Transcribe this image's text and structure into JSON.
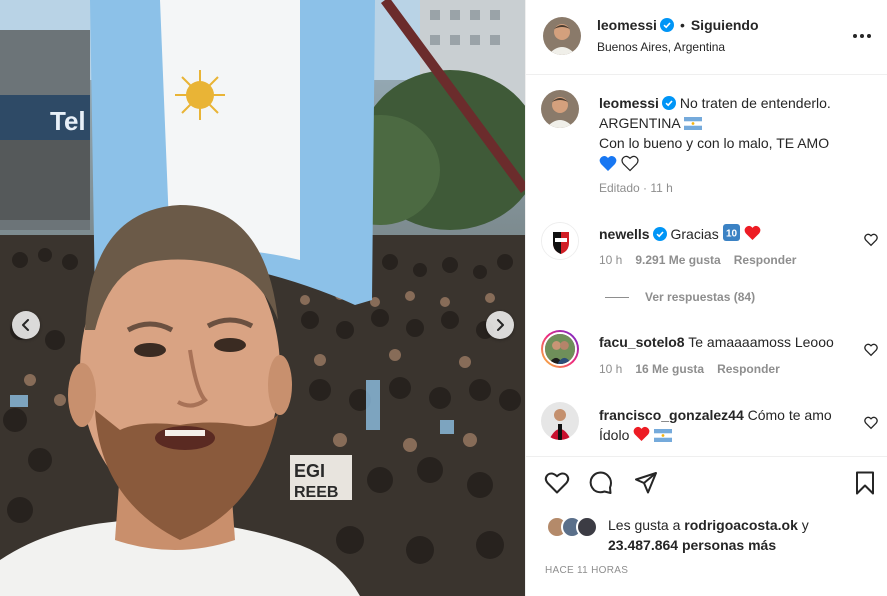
{
  "post": {
    "author": "leomessi",
    "follow_status": "Siguiendo",
    "location": "Buenos Aires, Argentina",
    "caption_line1": "No traten de entenderlo.",
    "caption_line2": "ARGENTINA",
    "caption_line3": "Con lo bueno y con lo malo, TE AMO",
    "edited": "Editado · 11 h",
    "photo_banner_text": "Tel",
    "photo_sign_text": "EGI",
    "photo_sign_text2": "REEB"
  },
  "comments": [
    {
      "user": "newells",
      "text": "Gracias",
      "time": "10 h",
      "likes": "9.291 Me gusta",
      "reply": "Responder",
      "view_replies": "Ver respuestas (84)"
    },
    {
      "user": "facu_sotelo8",
      "text": "Te amaaaamoss Leooo",
      "time": "10 h",
      "likes": "16 Me gusta",
      "reply": "Responder"
    },
    {
      "user": "francisco_gonzalez44",
      "text": "Cómo te amo",
      "text2": "Ídolo"
    }
  ],
  "likes": {
    "prefix": "Les gusta a",
    "user": "rodrigoacosta.ok",
    "suffix": "y",
    "count": "23.487.864 personas más"
  },
  "timestamp": "HACE 11 HORAS",
  "icons": {
    "verified": "verified-badge-icon",
    "more": "more-options-icon",
    "like": "heart-icon",
    "comment": "comment-icon",
    "share": "share-icon",
    "save": "bookmark-icon"
  },
  "colors": {
    "verified": "#0095f6",
    "text": "#262626",
    "muted": "#8e8e8e",
    "heart_red": "#ed1c24",
    "heart_blue": "#1877f2",
    "flag_blue": "#75aadb"
  }
}
